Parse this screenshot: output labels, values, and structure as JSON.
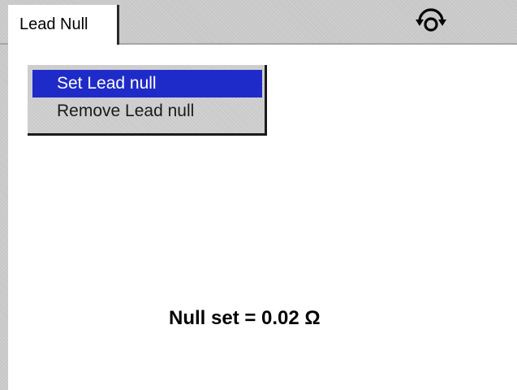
{
  "header": {
    "tab_label": "Lead Null",
    "refresh_icon": "refresh-icon"
  },
  "menu": {
    "items": [
      {
        "label": "Set Lead null",
        "selected": true
      },
      {
        "label": "Remove Lead null",
        "selected": false
      }
    ],
    "selected_color": "#1f2bc8"
  },
  "status": {
    "text": "Null set = 0.02 Ω"
  }
}
